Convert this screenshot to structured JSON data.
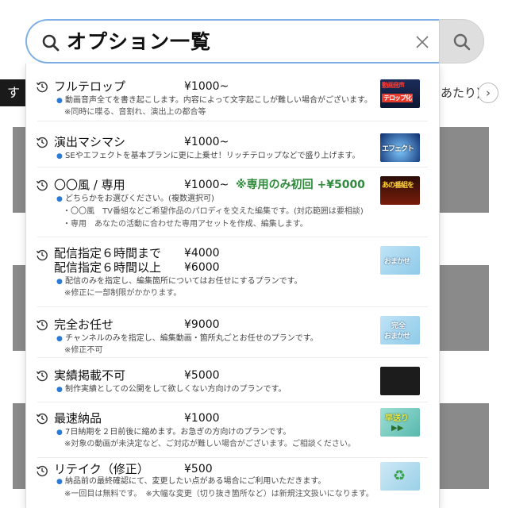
{
  "search": {
    "query": "オプション一覧"
  },
  "background": {
    "category_first": "すべ",
    "category_right": "あたり)"
  },
  "options": [
    {
      "name": "フルテロップ",
      "price": "¥1000~",
      "desc": "動画音声全てを書き起こします。内容によって文字起こしが難しい場合がございます。",
      "sub": [
        "※同時に喋る、音割れ、演出上の都合等"
      ],
      "thumb": "フルテロップ化",
      "thumb_line1": "動画音声",
      "thumb_line2": "テロップ化"
    },
    {
      "name": "演出マシマシ",
      "price": "¥1000~",
      "desc": "SEやエフェクトを基本プランに更に上乗せ！リッチテロップなどで盛り上げます。",
      "sub": [],
      "thumb": "エフェクト"
    },
    {
      "name": "〇〇風 / 専用",
      "price": "¥1000~",
      "note": "※専用のみ初回 +¥5000",
      "desc": "どちらかをお選びください。(複数選択可)",
      "sub": [
        "・〇〇風　TV番組などご希望作品のパロディを交えた編集です。(対応範囲は要相談)",
        "・専用　あなたの活動に合わせた専用アセットを作成、編集します。"
      ],
      "thumb": "あの番組を"
    },
    {
      "name": "配信指定６時間まで",
      "price": "¥4000",
      "name2": "配信指定６時間以上",
      "price2": "¥6000",
      "desc": "配信のみを指定し、編集箇所についてはお任せにするプランです。",
      "sub": [
        "※修正に一部制限がかかります。"
      ],
      "thumb": "おまかせ"
    },
    {
      "name": "完全お任せ",
      "price": "¥9000",
      "desc": "チャンネルのみを指定し、編集動画・箇所丸ごとお任せのプランです。",
      "sub": [
        "※修正不可"
      ],
      "thumb": "完全おまかせ",
      "thumb_line1": "完全",
      "thumb_line2": "おまかせ"
    },
    {
      "name": "実績掲載不可",
      "price": "¥5000",
      "desc": "制作実績としての公開をして欲しくない方向けのプランです。",
      "sub": [],
      "thumb": ""
    },
    {
      "name": "最速納品",
      "price": "¥1000",
      "desc": "7日納期を２日前後に縮めます。お急ぎの方向けのプランです。",
      "sub": [
        "※対象の動画が未決定など、ご対応が難しい場合がございます。ご相談ください。"
      ],
      "thumb": "早送り"
    },
    {
      "name": "リテイク（修正）",
      "price": "¥500",
      "desc": "納品前の最終確認にて、変更したい点がある場合にご利用いただきます。",
      "sub": [
        "※一回目は無料です。　※大幅な変更（切り抜き箇所など）は新規注文扱いになります。"
      ],
      "thumb": ""
    }
  ],
  "colors": {
    "search_border": "#7fb1e6",
    "note_green": "#2e8b3b",
    "bullet_blue": "#2b7bd6"
  }
}
